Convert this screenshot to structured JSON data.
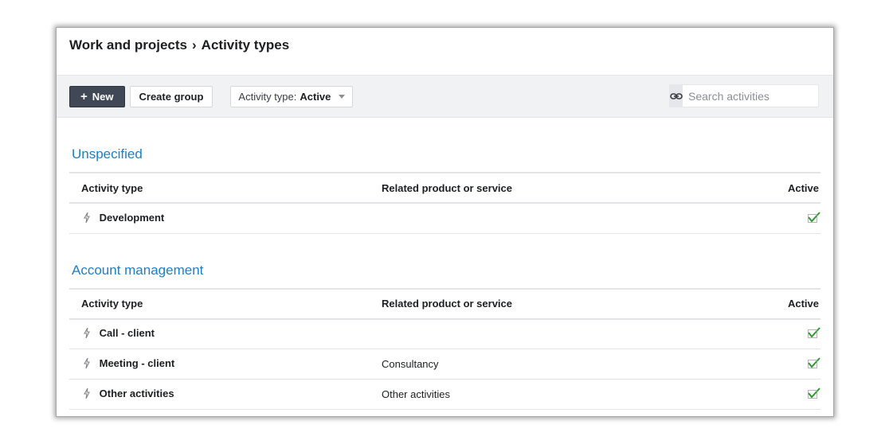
{
  "breadcrumb": {
    "parent": "Work and projects",
    "separator": "›",
    "current": "Activity types"
  },
  "toolbar": {
    "new_label": "New",
    "create_group_label": "Create group",
    "filter_label": "Activity type:",
    "filter_value": "Active",
    "search_placeholder": "Search activities"
  },
  "columns": {
    "activity_type": "Activity type",
    "related": "Related product or service",
    "active": "Active"
  },
  "sections": [
    {
      "title": "Unspecified",
      "rows": [
        {
          "name": "Development",
          "related": "",
          "active": true
        }
      ]
    },
    {
      "title": "Account management",
      "rows": [
        {
          "name": "Call - client",
          "related": "",
          "active": true
        },
        {
          "name": "Meeting - client",
          "related": "Consultancy",
          "active": true
        },
        {
          "name": "Other activities",
          "related": "Other activities",
          "active": true
        }
      ]
    }
  ],
  "icons": {
    "row_icon": "lightning-bolt-icon",
    "active_icon": "checkmark-icon",
    "search_prefix_icon": "link-icon"
  },
  "colors": {
    "accent": "#1f7fc4",
    "primary_button": "#3f4854",
    "check": "#2e9a2e"
  }
}
